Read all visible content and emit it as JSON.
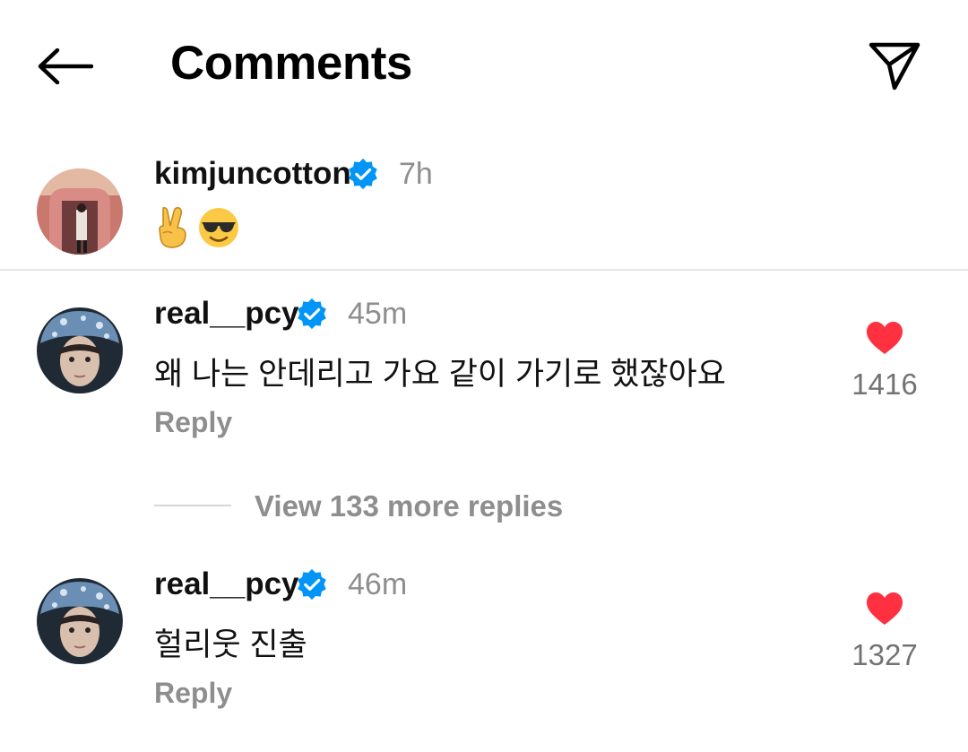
{
  "header": {
    "title": "Comments",
    "back_icon": "arrow-left-icon",
    "share_icon": "paper-plane-icon"
  },
  "caption": {
    "username": "kimjuncotton",
    "verified": true,
    "time": "7h",
    "text_emoji": [
      "victory-hand-emoji",
      "smiling-face-with-sunglasses-emoji"
    ]
  },
  "comments": [
    {
      "username": "real__pcy",
      "verified": true,
      "time": "45m",
      "text": "왜 나는 안데리고 가요 같이 가기로 했잖아요",
      "reply_label": "Reply",
      "likes": "1416"
    },
    {
      "username": "real__pcy",
      "verified": true,
      "time": "46m",
      "text": "헐리웃 진출",
      "reply_label": "Reply",
      "likes": "1327"
    }
  ],
  "view_more_replies": "View 133 more replies",
  "colors": {
    "verified_blue": "#0095f6",
    "heart_red": "#ff3040",
    "muted_text": "#8e8e8e"
  }
}
